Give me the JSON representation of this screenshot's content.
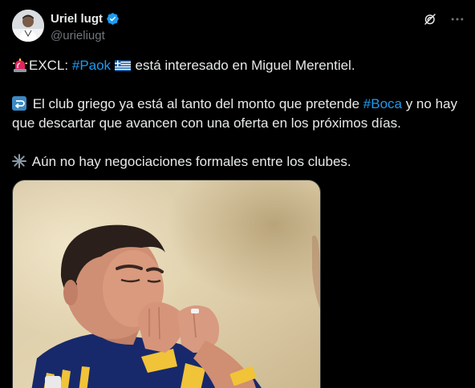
{
  "author": {
    "display_name": "Uriel lugt",
    "handle": "@urieliugt",
    "verified": true
  },
  "icons": {
    "verified": "verified-badge-icon",
    "grok": "grok-icon",
    "more": "more-icon",
    "siren": "siren-emoji",
    "flag": "greece-flag-emoji",
    "loop": "loop-arrow-emoji",
    "sparkle": "sparkle-emoji"
  },
  "tweet": {
    "line1_prefix": "EXCL: ",
    "hashtag_paok": "#Paok",
    "line1_suffix": " está interesado en Miguel Merentiel.",
    "line2_prefix": " El club griego ya está al tanto del monto que pretende ",
    "hashtag_boca": "#Boca",
    "line2_suffix": " y no hay que descartar que avancen con una oferta en los próximos días.",
    "line3": " Aún no hay negociaciones formales entre los clubes."
  },
  "colors": {
    "background": "#000000",
    "text": "#e7e9ea",
    "secondary": "#71767b",
    "link": "#1d9bf0",
    "verified": "#1d9bf0"
  }
}
